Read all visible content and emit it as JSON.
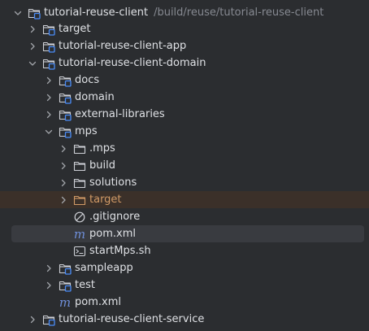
{
  "tree": {
    "root": {
      "label": "tutorial-reuse-client",
      "path": "/build/reuse/tutorial-reuse-client"
    },
    "target": {
      "label": "target"
    },
    "app": {
      "label": "tutorial-reuse-client-app"
    },
    "domain": {
      "label": "tutorial-reuse-client-domain"
    },
    "docs": {
      "label": "docs"
    },
    "domain_sub": {
      "label": "domain"
    },
    "external": {
      "label": "external-libraries"
    },
    "mps": {
      "label": "mps"
    },
    "dot_mps": {
      "label": ".mps"
    },
    "build": {
      "label": "build"
    },
    "solutions": {
      "label": "solutions"
    },
    "mps_target": {
      "label": "target"
    },
    "gitignore": {
      "label": ".gitignore"
    },
    "mps_pom": {
      "label": "pom.xml"
    },
    "startmps": {
      "label": "startMps.sh"
    },
    "sampleapp": {
      "label": "sampleapp"
    },
    "test": {
      "label": "test"
    },
    "domain_pom": {
      "label": "pom.xml"
    },
    "service": {
      "label": "tutorial-reuse-client-service"
    }
  },
  "colors": {
    "background": "#2b2d30",
    "selection": "#393b40",
    "highlight_row": "#3b3029",
    "text": "#dfe1e5",
    "path_text": "#868991",
    "excluded_text": "#d19a66",
    "module_badge": "#4a8df8"
  },
  "icons": {
    "chevron_collapsed": "chevron-right-icon",
    "chevron_expanded": "chevron-down-icon",
    "module_folder": "module-folder-icon",
    "folder": "folder-icon",
    "excluded_folder": "excluded-folder-icon",
    "ignore_file": "ignore-file-icon",
    "maven_file": "maven-file-icon",
    "shell_file": "shell-script-icon"
  }
}
